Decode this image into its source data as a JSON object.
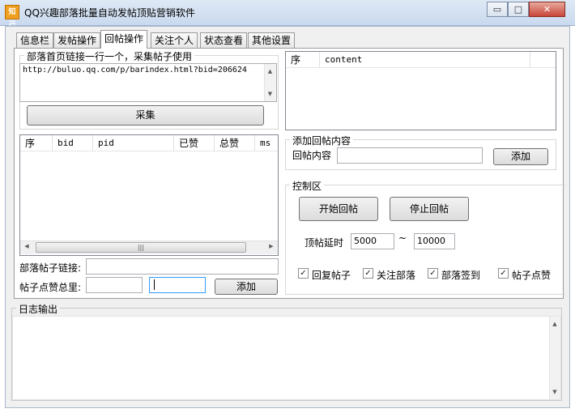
{
  "window": {
    "title": "QQ兴趣部落批量自动发帖顶贴营销软件",
    "icon_text": "知己",
    "controls": {
      "minimize": "▭",
      "maximize": "□",
      "close": "✕"
    }
  },
  "tabs": [
    {
      "label": "信息栏",
      "active": false
    },
    {
      "label": "发帖操作",
      "active": false
    },
    {
      "label": "回帖操作",
      "active": true
    },
    {
      "label": "关注个人",
      "active": false
    },
    {
      "label": "状态查看",
      "active": false
    },
    {
      "label": "其他设置",
      "active": false
    }
  ],
  "link_section": {
    "legend": "部落首页链接一行一个，采集帖子使用",
    "url_text": "http://buluo.qq.com/p/barindex.html?bid=206624",
    "collect_button": "采集"
  },
  "posts_grid": {
    "columns": [
      "序",
      "bid",
      "pid",
      "已赞",
      "总赞",
      "ms"
    ],
    "hscroll_thumb": "|||"
  },
  "form": {
    "post_link_label": "部落帖子链接:",
    "post_link_value": "",
    "total_likes_label": "帖子点赞总里:",
    "total_likes_value": "",
    "extra_value": "",
    "add_button": "添加"
  },
  "content_grid": {
    "columns": [
      "序",
      "content"
    ]
  },
  "reply_section": {
    "legend": "添加回帖内容",
    "content_label": "回帖内容",
    "content_value": "",
    "add_button": "添加"
  },
  "control": {
    "legend": "控制区",
    "start_button": "开始回帖",
    "stop_button": "停止回帖",
    "delay_label": "顶帖延时",
    "delay_min": "5000",
    "delay_sep": "~",
    "delay_max": "10000",
    "checkboxes": [
      {
        "label": "回复帖子",
        "checked": true
      },
      {
        "label": "关注部落",
        "checked": true
      },
      {
        "label": "部落签到",
        "checked": true
      },
      {
        "label": "帖子点赞",
        "checked": true
      }
    ]
  },
  "log": {
    "legend": "日志输出",
    "content": ""
  },
  "glyphs": {
    "check": "✓",
    "arrow_up": "▲",
    "arrow_down": "▼",
    "arrow_left": "◀",
    "arrow_right": "▶"
  }
}
